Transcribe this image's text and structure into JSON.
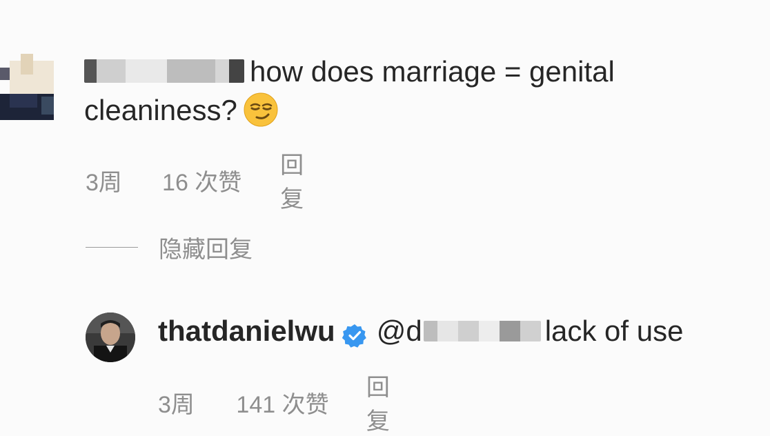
{
  "comment1": {
    "text_line1": "how does marriage = genital",
    "text_line2": "cleaniness?",
    "emoji_icon": "smirking-face-emoji",
    "time": "3周",
    "likes": "16 次赞",
    "reply": "回复"
  },
  "hide_replies": {
    "label": "隐藏回复"
  },
  "comment2": {
    "username": "thatdanielwu",
    "verified_icon": "verified-badge-icon",
    "mention_prefix": "@d",
    "text": "lack of use",
    "time": "3周",
    "likes": "141 次赞",
    "reply": "回复"
  },
  "colors": {
    "text": "#262626",
    "meta": "#8e8e8e",
    "verified": "#3897f0"
  }
}
